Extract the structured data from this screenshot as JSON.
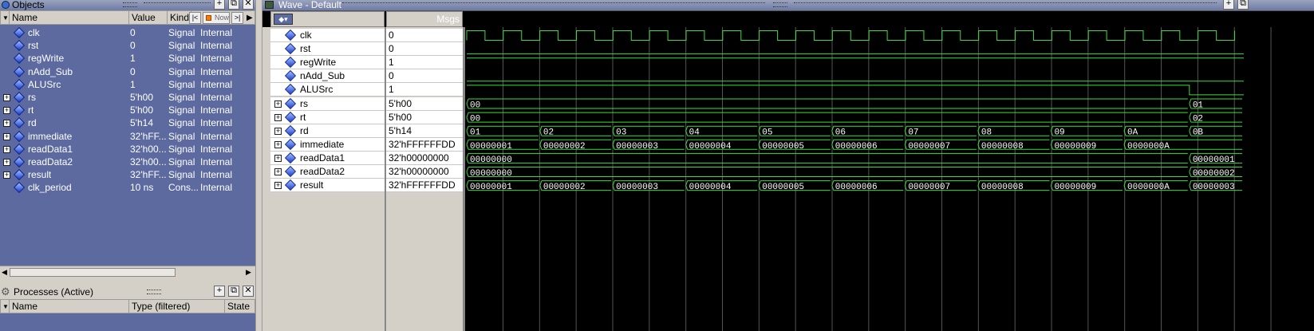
{
  "objects": {
    "title": "Objects",
    "cols": {
      "name": "Name",
      "value": "Value",
      "kind": "Kind"
    },
    "now_label": "Now",
    "rows": [
      {
        "name": "clk",
        "value": "0",
        "kind": "Signal",
        "mode": "Internal",
        "exp": false
      },
      {
        "name": "rst",
        "value": "0",
        "kind": "Signal",
        "mode": "Internal",
        "exp": false
      },
      {
        "name": "regWrite",
        "value": "1",
        "kind": "Signal",
        "mode": "Internal",
        "exp": false
      },
      {
        "name": "nAdd_Sub",
        "value": "0",
        "kind": "Signal",
        "mode": "Internal",
        "exp": false
      },
      {
        "name": "ALUSrc",
        "value": "1",
        "kind": "Signal",
        "mode": "Internal",
        "exp": false
      },
      {
        "name": "rs",
        "value": "5'h00",
        "kind": "Signal",
        "mode": "Internal",
        "exp": true
      },
      {
        "name": "rt",
        "value": "5'h00",
        "kind": "Signal",
        "mode": "Internal",
        "exp": true
      },
      {
        "name": "rd",
        "value": "5'h14",
        "kind": "Signal",
        "mode": "Internal",
        "exp": true
      },
      {
        "name": "immediate",
        "value": "32'hFF...",
        "kind": "Signal",
        "mode": "Internal",
        "exp": true
      },
      {
        "name": "readData1",
        "value": "32'h00...",
        "kind": "Signal",
        "mode": "Internal",
        "exp": true
      },
      {
        "name": "readData2",
        "value": "32'h00...",
        "kind": "Signal",
        "mode": "Internal",
        "exp": true
      },
      {
        "name": "result",
        "value": "32'hFF...",
        "kind": "Signal",
        "mode": "Internal",
        "exp": true
      },
      {
        "name": "clk_period",
        "value": "10 ns",
        "kind": "Cons...",
        "mode": "Internal",
        "exp": false
      }
    ]
  },
  "processes": {
    "title": "Processes (Active)",
    "cols": {
      "name": "Name",
      "type": "Type (filtered)",
      "state": "State"
    }
  },
  "wave": {
    "title": "Wave - Default",
    "msgs_label": "Msgs",
    "rows": [
      {
        "name": "clk",
        "value": "0",
        "exp": false
      },
      {
        "name": "rst",
        "value": "0",
        "exp": false
      },
      {
        "name": "regWrite",
        "value": "1",
        "exp": false
      },
      {
        "name": "nAdd_Sub",
        "value": "0",
        "exp": false
      },
      {
        "name": "ALUSrc",
        "value": "1",
        "exp": false
      },
      {
        "name": "rs",
        "value": "5'h00",
        "exp": true
      },
      {
        "name": "rt",
        "value": "5'h00",
        "exp": true
      },
      {
        "name": "rd",
        "value": "5'h14",
        "exp": true
      },
      {
        "name": "immediate",
        "value": "32'hFFFFFFDD",
        "exp": true
      },
      {
        "name": "readData1",
        "value": "32'h00000000",
        "exp": true
      },
      {
        "name": "readData2",
        "value": "32'h00000000",
        "exp": true
      },
      {
        "name": "result",
        "value": "32'hFFFFFFDD",
        "exp": true
      }
    ],
    "waveforms": [
      {
        "type": "clock",
        "periods": 21,
        "alpha": 0.036
      },
      {
        "type": "bit",
        "segments": [
          [
            0,
            1,
            0
          ]
        ]
      },
      {
        "type": "bit",
        "segments": [
          [
            0,
            1,
            1
          ]
        ]
      },
      {
        "type": "bit",
        "segments": [
          [
            0,
            1,
            0
          ]
        ]
      },
      {
        "type": "bit",
        "segments": [
          [
            0,
            0.93,
            1
          ],
          [
            0.93,
            1,
            0
          ]
        ]
      },
      {
        "type": "bus",
        "labels": [
          "00",
          "01"
        ],
        "changes": [
          0,
          0.93,
          1
        ]
      },
      {
        "type": "bus",
        "labels": [
          "00",
          "02"
        ],
        "changes": [
          0,
          0.93,
          1
        ]
      },
      {
        "type": "bus",
        "labels": [
          "01",
          "02",
          "03",
          "04",
          "05",
          "06",
          "07",
          "08",
          "09",
          "0A",
          "0B"
        ],
        "changes": [
          0,
          0.0943,
          0.188,
          0.282,
          0.376,
          0.47,
          0.564,
          0.658,
          0.752,
          0.846,
          0.93,
          1
        ]
      },
      {
        "type": "bus",
        "labels": [
          "00000001",
          "00000002",
          "00000003",
          "00000004",
          "00000005",
          "00000006",
          "00000007",
          "00000008",
          "00000009",
          "0000000A"
        ],
        "changes": [
          0,
          0.0943,
          0.188,
          0.282,
          0.376,
          0.47,
          0.564,
          0.658,
          0.752,
          0.846,
          1
        ]
      },
      {
        "type": "bus",
        "labels": [
          "00000000",
          "00000001"
        ],
        "changes": [
          0,
          0.93,
          1
        ]
      },
      {
        "type": "bus",
        "labels": [
          "00000000",
          "00000002"
        ],
        "changes": [
          0,
          0.93,
          1
        ]
      },
      {
        "type": "bus",
        "labels": [
          "00000001",
          "00000002",
          "00000003",
          "00000004",
          "00000005",
          "00000006",
          "00000007",
          "00000008",
          "00000009",
          "0000000A",
          "00000003"
        ],
        "changes": [
          0,
          0.0943,
          0.188,
          0.282,
          0.376,
          0.47,
          0.564,
          0.658,
          0.752,
          0.846,
          0.93,
          1
        ]
      }
    ]
  },
  "colors": {
    "wave": "#3ddc3d",
    "panel": "#5d6aa0",
    "background": "#000000"
  },
  "icons": [
    "diamond-signal-icon",
    "plus-expand-icon",
    "gear-icon",
    "close-icon",
    "float-icon",
    "add-icon"
  ]
}
